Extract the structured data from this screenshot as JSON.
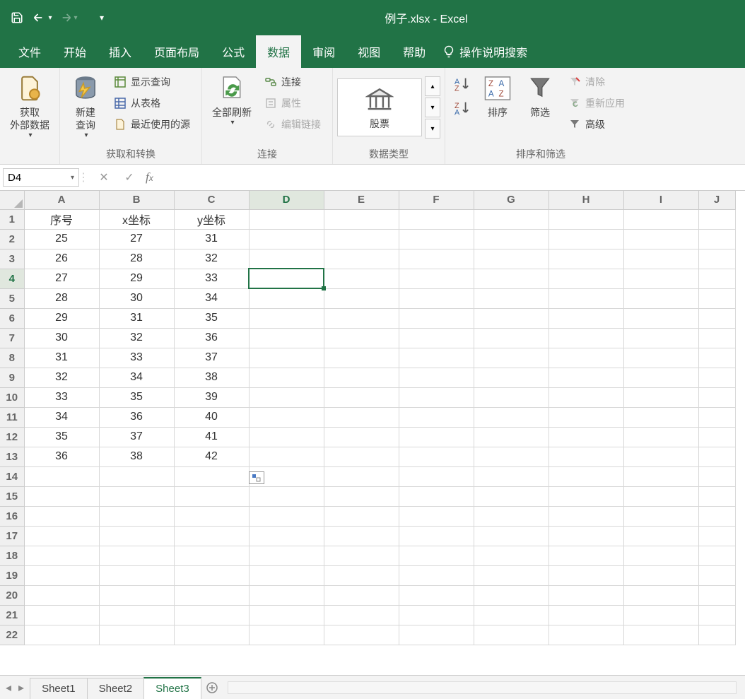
{
  "title": "例子.xlsx  -  Excel",
  "ribbon_tabs": [
    "文件",
    "开始",
    "插入",
    "页面布局",
    "公式",
    "数据",
    "审阅",
    "视图",
    "帮助"
  ],
  "active_tab_index": 5,
  "tell_me": "操作说明搜索",
  "ribbon": {
    "group1": {
      "label": "",
      "get_external": "获取\n外部数据"
    },
    "group2": {
      "label": "获取和转换",
      "new_query": "新建\n查询",
      "show_queries": "显示查询",
      "from_table": "从表格",
      "recent_sources": "最近使用的源"
    },
    "group3": {
      "label": "连接",
      "refresh_all": "全部刷新",
      "connections": "连接",
      "properties": "属性",
      "edit_links": "编辑链接"
    },
    "group4": {
      "label": "数据类型",
      "stocks": "股票"
    },
    "group5": {
      "label": "排序和筛选",
      "sort": "排序",
      "filter": "筛选",
      "clear": "清除",
      "reapply": "重新应用",
      "advanced": "高级"
    }
  },
  "name_box": "D4",
  "formula": "",
  "columns": [
    "A",
    "B",
    "C",
    "D",
    "E",
    "F",
    "G",
    "H",
    "I",
    "J"
  ],
  "row_count": 22,
  "selected_cell": {
    "row": 4,
    "col": "D"
  },
  "headers": [
    "序号",
    "x坐标",
    "y坐标"
  ],
  "data_rows": [
    [
      25,
      27,
      31
    ],
    [
      26,
      28,
      32
    ],
    [
      27,
      29,
      33
    ],
    [
      28,
      30,
      34
    ],
    [
      29,
      31,
      35
    ],
    [
      30,
      32,
      36
    ],
    [
      31,
      33,
      37
    ],
    [
      32,
      34,
      38
    ],
    [
      33,
      35,
      39
    ],
    [
      34,
      36,
      40
    ],
    [
      35,
      37,
      41
    ],
    [
      36,
      38,
      42
    ]
  ],
  "sheet_tabs": [
    "Sheet1",
    "Sheet2",
    "Sheet3"
  ],
  "active_sheet_index": 2
}
